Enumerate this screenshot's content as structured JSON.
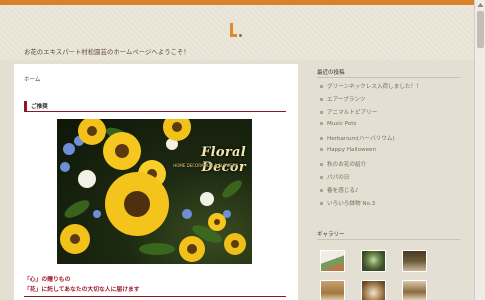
{
  "header": {
    "logo_icon": "orange-block-logo",
    "tagline": "お花のエキスパート村松園芸のホームページへようこそ！"
  },
  "main": {
    "breadcrumb": "ホーム",
    "section_title": "ご推奨",
    "hero": {
      "sign_text": "Floral Decor",
      "sub_text": "HOME DECORATION & FLOWERS"
    },
    "catch_line1": "「心」の贈りもの",
    "catch_line2": "「花」に託してあなたの大切な人に届けます"
  },
  "sidebar": {
    "recent_title": "最近の投稿",
    "recent_posts": [
      "グリーンネックレス入荷しました！！",
      "エアープランツ",
      "アニマルトピアリー",
      "Music Pots",
      "Herbarium(ハーバリウム)",
      "Happy Halloween",
      "秋のお花の紹介",
      "パパの日",
      "春を感じる♪",
      "いろいろ鉢物 No.3"
    ],
    "gallery_title": "ギャラリー"
  },
  "colors": {
    "accent_orange": "#d9822b",
    "section_red": "#8a1a28",
    "catch_red": "#a0162a"
  }
}
